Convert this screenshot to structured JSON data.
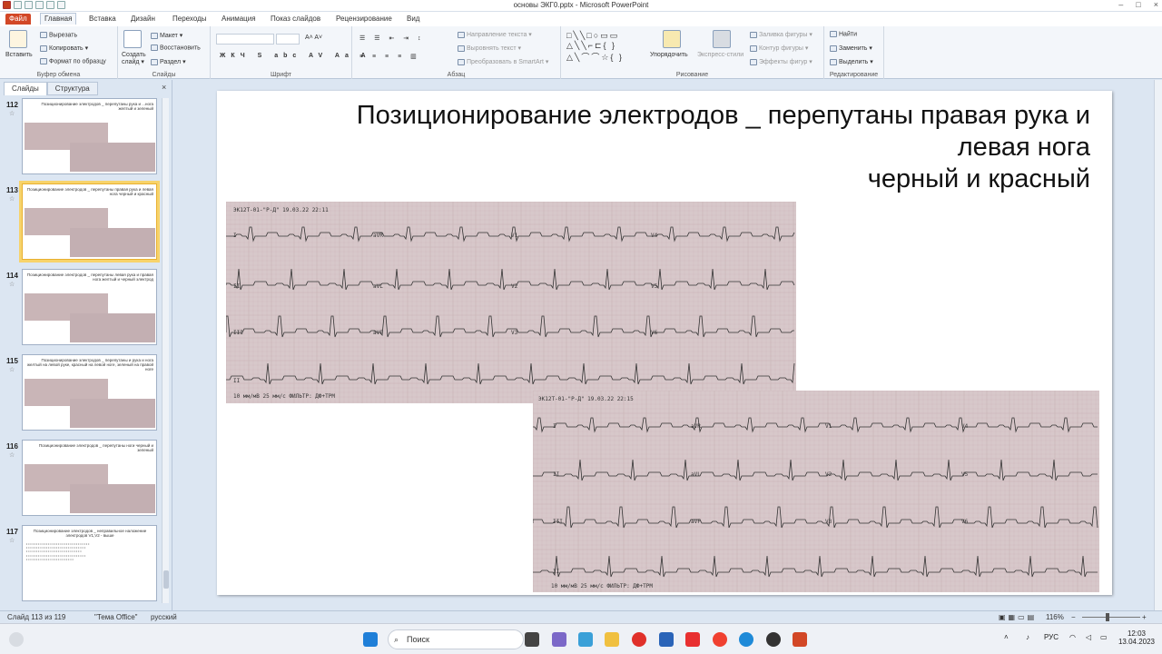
{
  "window": {
    "title": "основы ЭКГ0.pptx - Microsoft PowerPoint"
  },
  "tabs": [
    {
      "label": "Файл"
    },
    {
      "label": "Главная"
    },
    {
      "label": "Вставка"
    },
    {
      "label": "Дизайн"
    },
    {
      "label": "Переходы"
    },
    {
      "label": "Анимация"
    },
    {
      "label": "Показ слайдов"
    },
    {
      "label": "Рецензирование"
    },
    {
      "label": "Вид"
    }
  ],
  "ribbon": {
    "clipboard": {
      "label": "Буфер обмена",
      "paste": "Вставить",
      "cut": "Вырезать",
      "copy": "Копировать ▾",
      "format_painter": "Формат по образцу"
    },
    "slides": {
      "label": "Слайды",
      "new_slide": "Создать слайд ▾",
      "layout": "Макет ▾",
      "reset": "Восстановить",
      "section": "Раздел ▾"
    },
    "font": {
      "label": "Шрифт"
    },
    "paragraph": {
      "label": "Абзац",
      "direction": "Направление текста ▾",
      "align": "Выровнять текст ▾",
      "smartart": "Преобразовать в SmartArt ▾"
    },
    "drawing": {
      "label": "Рисование",
      "arrange": "Упорядочить",
      "quick_styles": "Экспресс-стили",
      "fill": "Заливка фигуры ▾",
      "outline": "Контур фигуры ▾",
      "effects": "Эффекты фигур ▾"
    },
    "editing": {
      "label": "Редактирование",
      "find": "Найти",
      "replace": "Заменить ▾",
      "select": "Выделить ▾"
    }
  },
  "panel": {
    "tab_slides": "Слайды",
    "tab_outline": "Структура",
    "close": "×"
  },
  "thumbnails": [
    {
      "num": "112",
      "title": "Позиционирование электродов _ перепутаны рука и ...нога желтый и зеленый"
    },
    {
      "num": "113",
      "title": "Позиционирование электродов _ перепутаны правая рука и левая нога черный и красный"
    },
    {
      "num": "114",
      "title": "Позиционирование электродов _ перепутаны левая рука и правая нога желтый и черный электрод"
    },
    {
      "num": "115",
      "title": "Позиционирование электродов _ перепутаны и рука и нога желтый на левой руке, красный на левой ноге, зеленый на правой ноге"
    },
    {
      "num": "116",
      "title": "Позиционирование электродов _ перепутаны ноги черный и зеленый"
    },
    {
      "num": "117",
      "title": "Позиционирование электродов _ неправильное наложение электродов V1,V2 - выше"
    }
  ],
  "slide": {
    "title_line1": "Позиционирование электродов _ перепутаны правая рука и",
    "title_line2": "левая нога",
    "title_line3": "черный и красный",
    "ecg1_header": "ЭК12Т-01-\"Р-Д\" 19.03.22 22:11",
    "ecg1_footer": "10 мм/мВ    25 мм/с ФИЛЬТР: ДФ+ТРМ",
    "ecg2_header": "ЭК12Т-01-\"Р-Д\" 19.03.22 22:15",
    "ecg2_footer": "10 мм/мВ    25 мм/с ФИЛЬТР: ДФ+ТРМ",
    "leads": {
      "r1": [
        "I",
        "aVR",
        "V1",
        "V4"
      ],
      "r2": [
        "II",
        "aVL",
        "V2",
        "V5"
      ],
      "r3": [
        "III",
        "aVF",
        "V3",
        "V6"
      ],
      "r4": [
        "II"
      ]
    }
  },
  "status": {
    "slide": "Слайд 113 из 119",
    "theme": "\"Тема Office\"",
    "lang": "русский",
    "zoom": "116%"
  },
  "taskbar": {
    "search": "Поиск",
    "lang": "РУС",
    "time": "12:03",
    "date": "13.04.2023"
  }
}
